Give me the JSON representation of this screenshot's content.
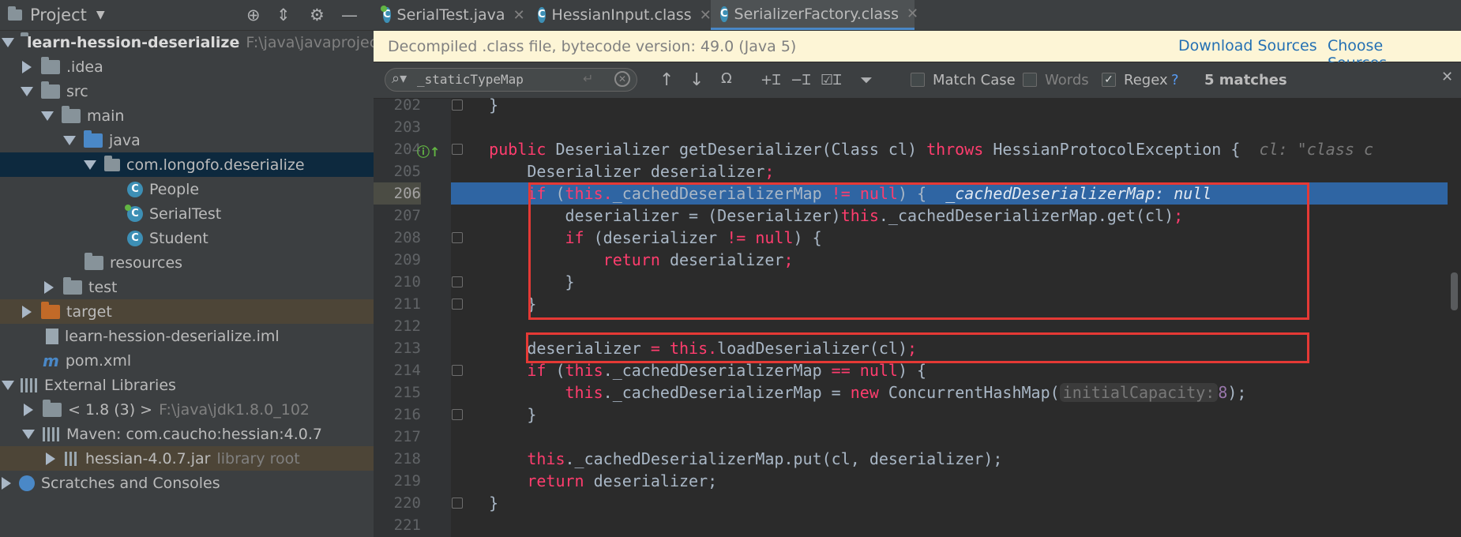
{
  "project_panel": {
    "title": "Project",
    "tree": [
      {
        "label": "learn-hession-deserialize",
        "extra": "F:\\java\\javaproject\\lea",
        "icon": "module-folder-icon"
      },
      {
        "label": ".idea",
        "icon": "folder-icon"
      },
      {
        "label": "src",
        "icon": "folder-icon"
      },
      {
        "label": "main",
        "icon": "folder-icon"
      },
      {
        "label": "java",
        "icon": "source-folder-icon"
      },
      {
        "label": "com.longofo.deserialize",
        "icon": "package-icon"
      },
      {
        "label": "People",
        "icon": "class-icon"
      },
      {
        "label": "SerialTest",
        "icon": "runnable-class-icon"
      },
      {
        "label": "Student",
        "icon": "class-icon"
      },
      {
        "label": "resources",
        "icon": "resources-folder-icon"
      },
      {
        "label": "test",
        "icon": "folder-icon"
      },
      {
        "label": "target",
        "icon": "excluded-folder-icon"
      },
      {
        "label": "learn-hession-deserialize.iml",
        "icon": "iml-file-icon"
      },
      {
        "label": "pom.xml",
        "icon": "maven-icon"
      },
      {
        "label": "External Libraries",
        "icon": "library-icon"
      },
      {
        "label": "< 1.8 (3) >",
        "extra": "F:\\java\\jdk1.8.0_102",
        "icon": "jdk-icon"
      },
      {
        "label": "Maven: com.caucho:hessian:4.0.7",
        "icon": "library-icon"
      },
      {
        "label": "hessian-4.0.7.jar",
        "extra": "library root",
        "icon": "jar-icon"
      },
      {
        "label": "Scratches and Consoles",
        "icon": "scratches-icon"
      }
    ]
  },
  "tabs": [
    {
      "label": "SerialTest.java",
      "icon": "runnable-class-icon"
    },
    {
      "label": "HessianInput.class",
      "icon": "class-icon"
    },
    {
      "label": "SerializerFactory.class",
      "icon": "class-icon",
      "active": true
    }
  ],
  "notice": {
    "text": "Decompiled .class file, bytecode version: 49.0 (Java 5)",
    "download_sources": "Download Sources",
    "choose_sources": "Choose Sources..."
  },
  "search": {
    "query": "_staticTypeMap",
    "match_case": "Match Case",
    "words": "Words",
    "regex": "Regex",
    "help": "?",
    "matches": "5 matches"
  },
  "code": {
    "line_numbers": [
      "202",
      "203",
      "204",
      "205",
      "206",
      "207",
      "208",
      "209",
      "210",
      "211",
      "212",
      "213",
      "214",
      "215",
      "216",
      "217",
      "218",
      "219",
      "220",
      "221"
    ],
    "l202": "    }",
    "l204_public": "public",
    "l204_sig": " Deserializer getDeserializer(Class cl) ",
    "l204_throws": "throws",
    "l204_exc": " HessianProtocolException {",
    "l204_inline": "cl: \"class c",
    "l205_a": "Deserializer deserializer",
    "l206_if": "if",
    "l206_this": "this.",
    "l206_field": "_cachedDeserializerMap",
    "l206_ne": " != ",
    "l206_null": "null",
    "l206_end": ") {",
    "l206_inline": "_cachedDeserializerMap: null",
    "l207_a": "deserializer",
    "l207_b": " = (Deserializer)",
    "l207_c": "._cachedDeserializerMap",
    "l207_d": ".get(cl)",
    "l208_a": "(deserializer ",
    "l208_b": "!= ",
    "l208_c": ") {",
    "l209_ret": "return",
    "l209_b": " deserializer",
    "l213_a": "deserializer",
    "l213_eq": " = ",
    "l213_this": "this.",
    "l213_b": "loadDeserializer(cl)",
    "l214_b": "._cachedDeserializerMap ",
    "l214_eq": "== ",
    "l215_a": "._cachedDeserializerMap = ",
    "l215_new": "new",
    "l215_b": " ConcurrentHashMap(",
    "l215_hint": "initialCapacity:",
    "l215_num": "8",
    "l215_end": ");",
    "l218_a": "._cachedDeserializerMap",
    "l218_b": ".put(cl",
    "l218_c": ", deserializer);",
    "l219_b": " deserializer;"
  },
  "colors": {
    "highlight_box": "#e53935",
    "current_line": "#2f65a3",
    "link": "#2470b3"
  }
}
